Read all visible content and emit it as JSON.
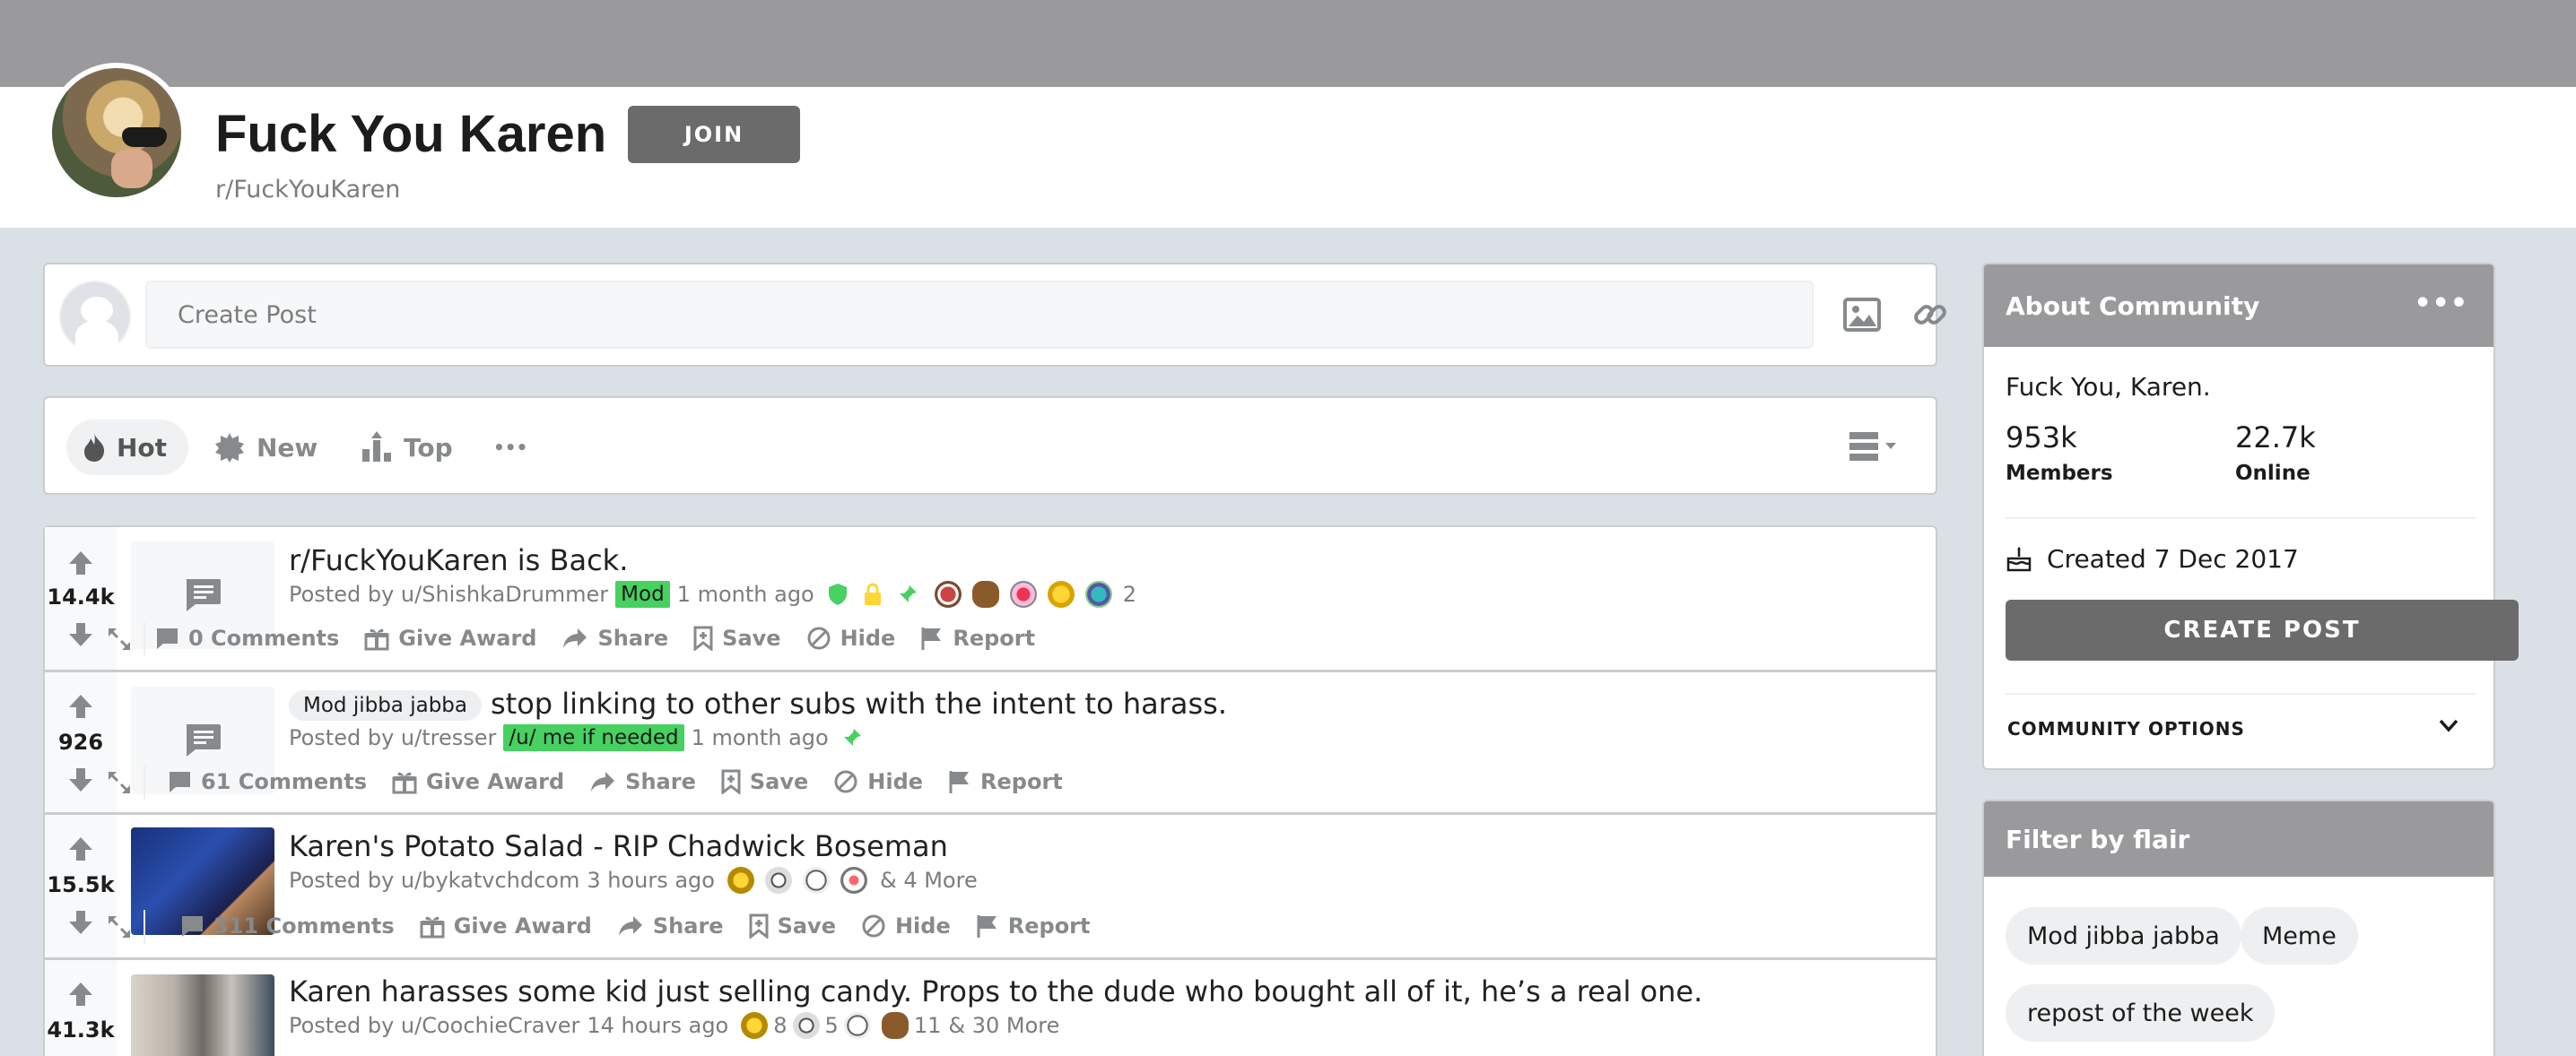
{
  "community": {
    "title": "Fuck You Karen",
    "name": "r/FuckYouKaren",
    "join_label": "JOIN"
  },
  "create_post": {
    "placeholder": "Create Post"
  },
  "sort": {
    "hot": "Hot",
    "new": "New",
    "top": "Top",
    "more": "•••"
  },
  "posts": [
    {
      "score": "14.4k",
      "title": "r/FuckYouKaren is Back.",
      "posted_by": "Posted by u/ShishkaDrummer",
      "flair": "Mod",
      "time": "1 month ago",
      "award_count": "2",
      "comments": "0 Comments"
    },
    {
      "score": "926",
      "post_flair": "Mod jibba jabba",
      "title": "stop linking to other subs with the intent to harass.",
      "posted_by": "Posted by u/tresser",
      "flair": "/u/ me if needed",
      "time": "1 month ago",
      "comments": "61 Comments"
    },
    {
      "score": "15.5k",
      "title": "Karen's Potato Salad - RIP Chadwick Boseman",
      "posted_by": "Posted by u/bykatvchdcom",
      "time": "3 hours ago",
      "more_awards": "& 4 More",
      "comments": "311 Comments"
    },
    {
      "score": "41.3k",
      "title": "Karen harasses some kid just selling candy. Props to the dude who bought all of it, he’s a real one.",
      "posted_by": "Posted by u/CoochieCraver",
      "time": "14 hours ago",
      "award_a": "8",
      "award_b": "5",
      "award_c": "11",
      "more_awards": "& 30 More"
    }
  ],
  "actions": {
    "give_award": "Give Award",
    "share": "Share",
    "save": "Save",
    "hide": "Hide",
    "report": "Report"
  },
  "about": {
    "header": "About Community",
    "description": "Fuck You, Karen.",
    "members_count": "953k",
    "members_label": "Members",
    "online_count": "22.7k",
    "online_label": "Online",
    "created": "Created 7 Dec 2017",
    "create_post_label": "CREATE POST",
    "options_label": "COMMUNITY OPTIONS"
  },
  "flair_filter": {
    "header": "Filter by flair",
    "items": [
      "Mod jibba jabba",
      "Meme",
      "repost of the week"
    ]
  },
  "colors": {
    "banner": "#9a999c",
    "button": "#6b6b6b",
    "mod_flair": "#46d160",
    "page_bg": "#dae0e6"
  }
}
